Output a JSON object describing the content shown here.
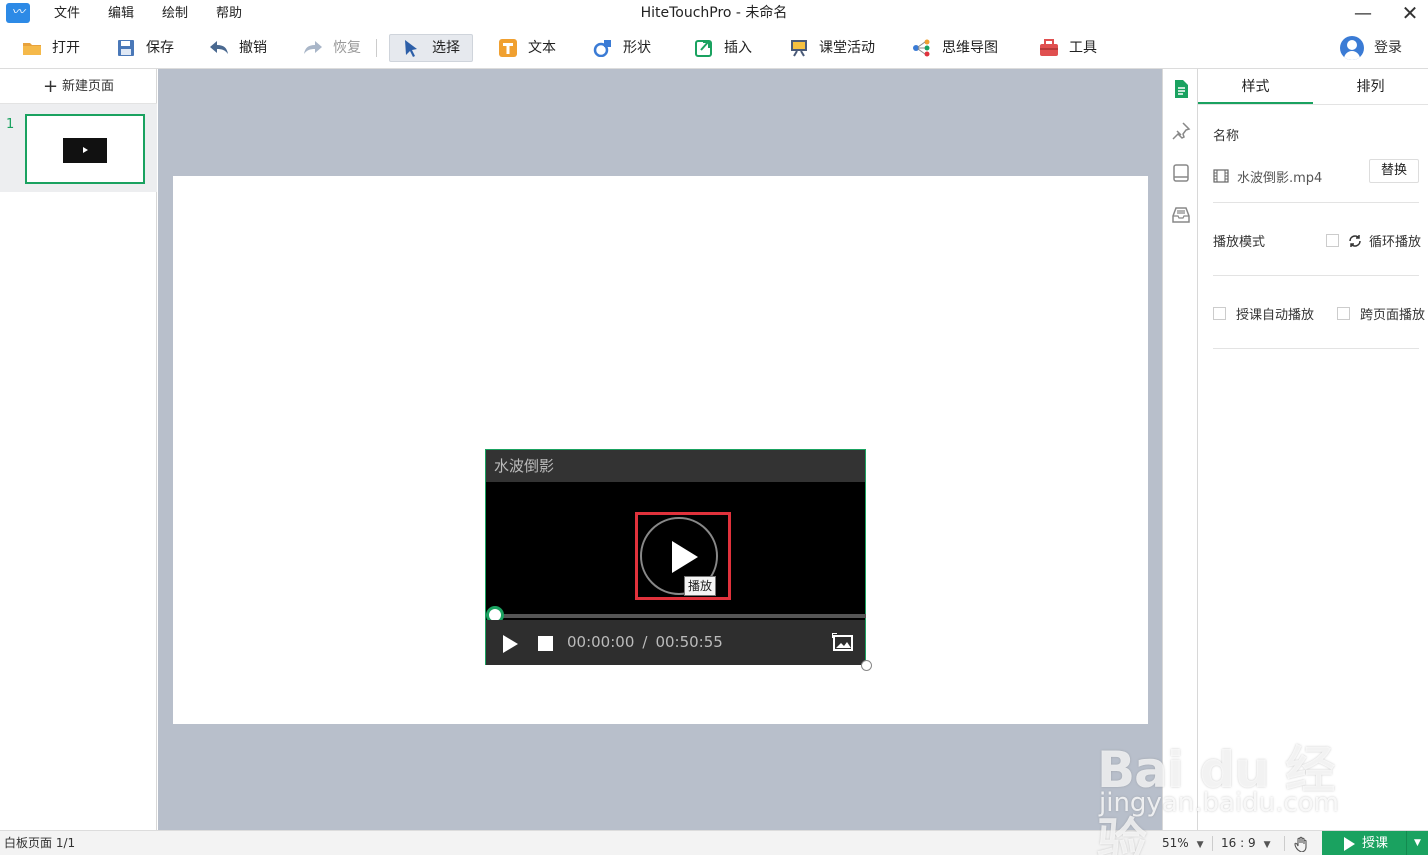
{
  "window": {
    "title": "HiteTouchPro - 未命名"
  },
  "menu": {
    "items": [
      "文件",
      "编辑",
      "绘制",
      "帮助"
    ]
  },
  "toolbar": {
    "open": "打开",
    "save": "保存",
    "undo": "撤销",
    "redo": "恢复",
    "select": "选择",
    "text": "文本",
    "shape": "形状",
    "insert": "插入",
    "classroom": "课堂活动",
    "mindmap": "思维导图",
    "tools": "工具",
    "login": "登录"
  },
  "pages": {
    "new_page": "新建页面",
    "items": [
      {
        "number": "1"
      }
    ]
  },
  "video": {
    "title": "水波倒影",
    "tooltip": "播放",
    "current_time": "00:00:00",
    "separator": "/",
    "duration": "00:50:55",
    "progress": 0
  },
  "properties": {
    "tabs": [
      "样式",
      "排列"
    ],
    "name_label": "名称",
    "file_name": "水波倒影.mp4",
    "replace": "替换",
    "play_mode_label": "播放模式",
    "loop_play": "循环播放",
    "auto_play": "授课自动播放",
    "cross_page": "跨页面播放"
  },
  "status": {
    "page_info": "白板页面 1/1",
    "zoom": "51%",
    "ratio": "16 : 9",
    "teach": "授课"
  },
  "watermark": {
    "main": "Bai du 经验",
    "sub": "jingyan.baidu.com"
  },
  "colors": {
    "accent": "#1aa260",
    "highlight_box": "#e0323c",
    "canvas_bg": "#b8bfcb",
    "video_header": "#333333"
  },
  "icons": {
    "open": "folder-icon",
    "save": "floppy-icon",
    "undo": "undo-arrow-icon",
    "redo": "redo-arrow-icon",
    "select": "cursor-icon",
    "text": "text-t-icon",
    "shape": "shape-icon",
    "insert": "insert-icon",
    "classroom": "easel-icon",
    "mindmap": "mindmap-icon",
    "tools": "toolbox-icon"
  }
}
